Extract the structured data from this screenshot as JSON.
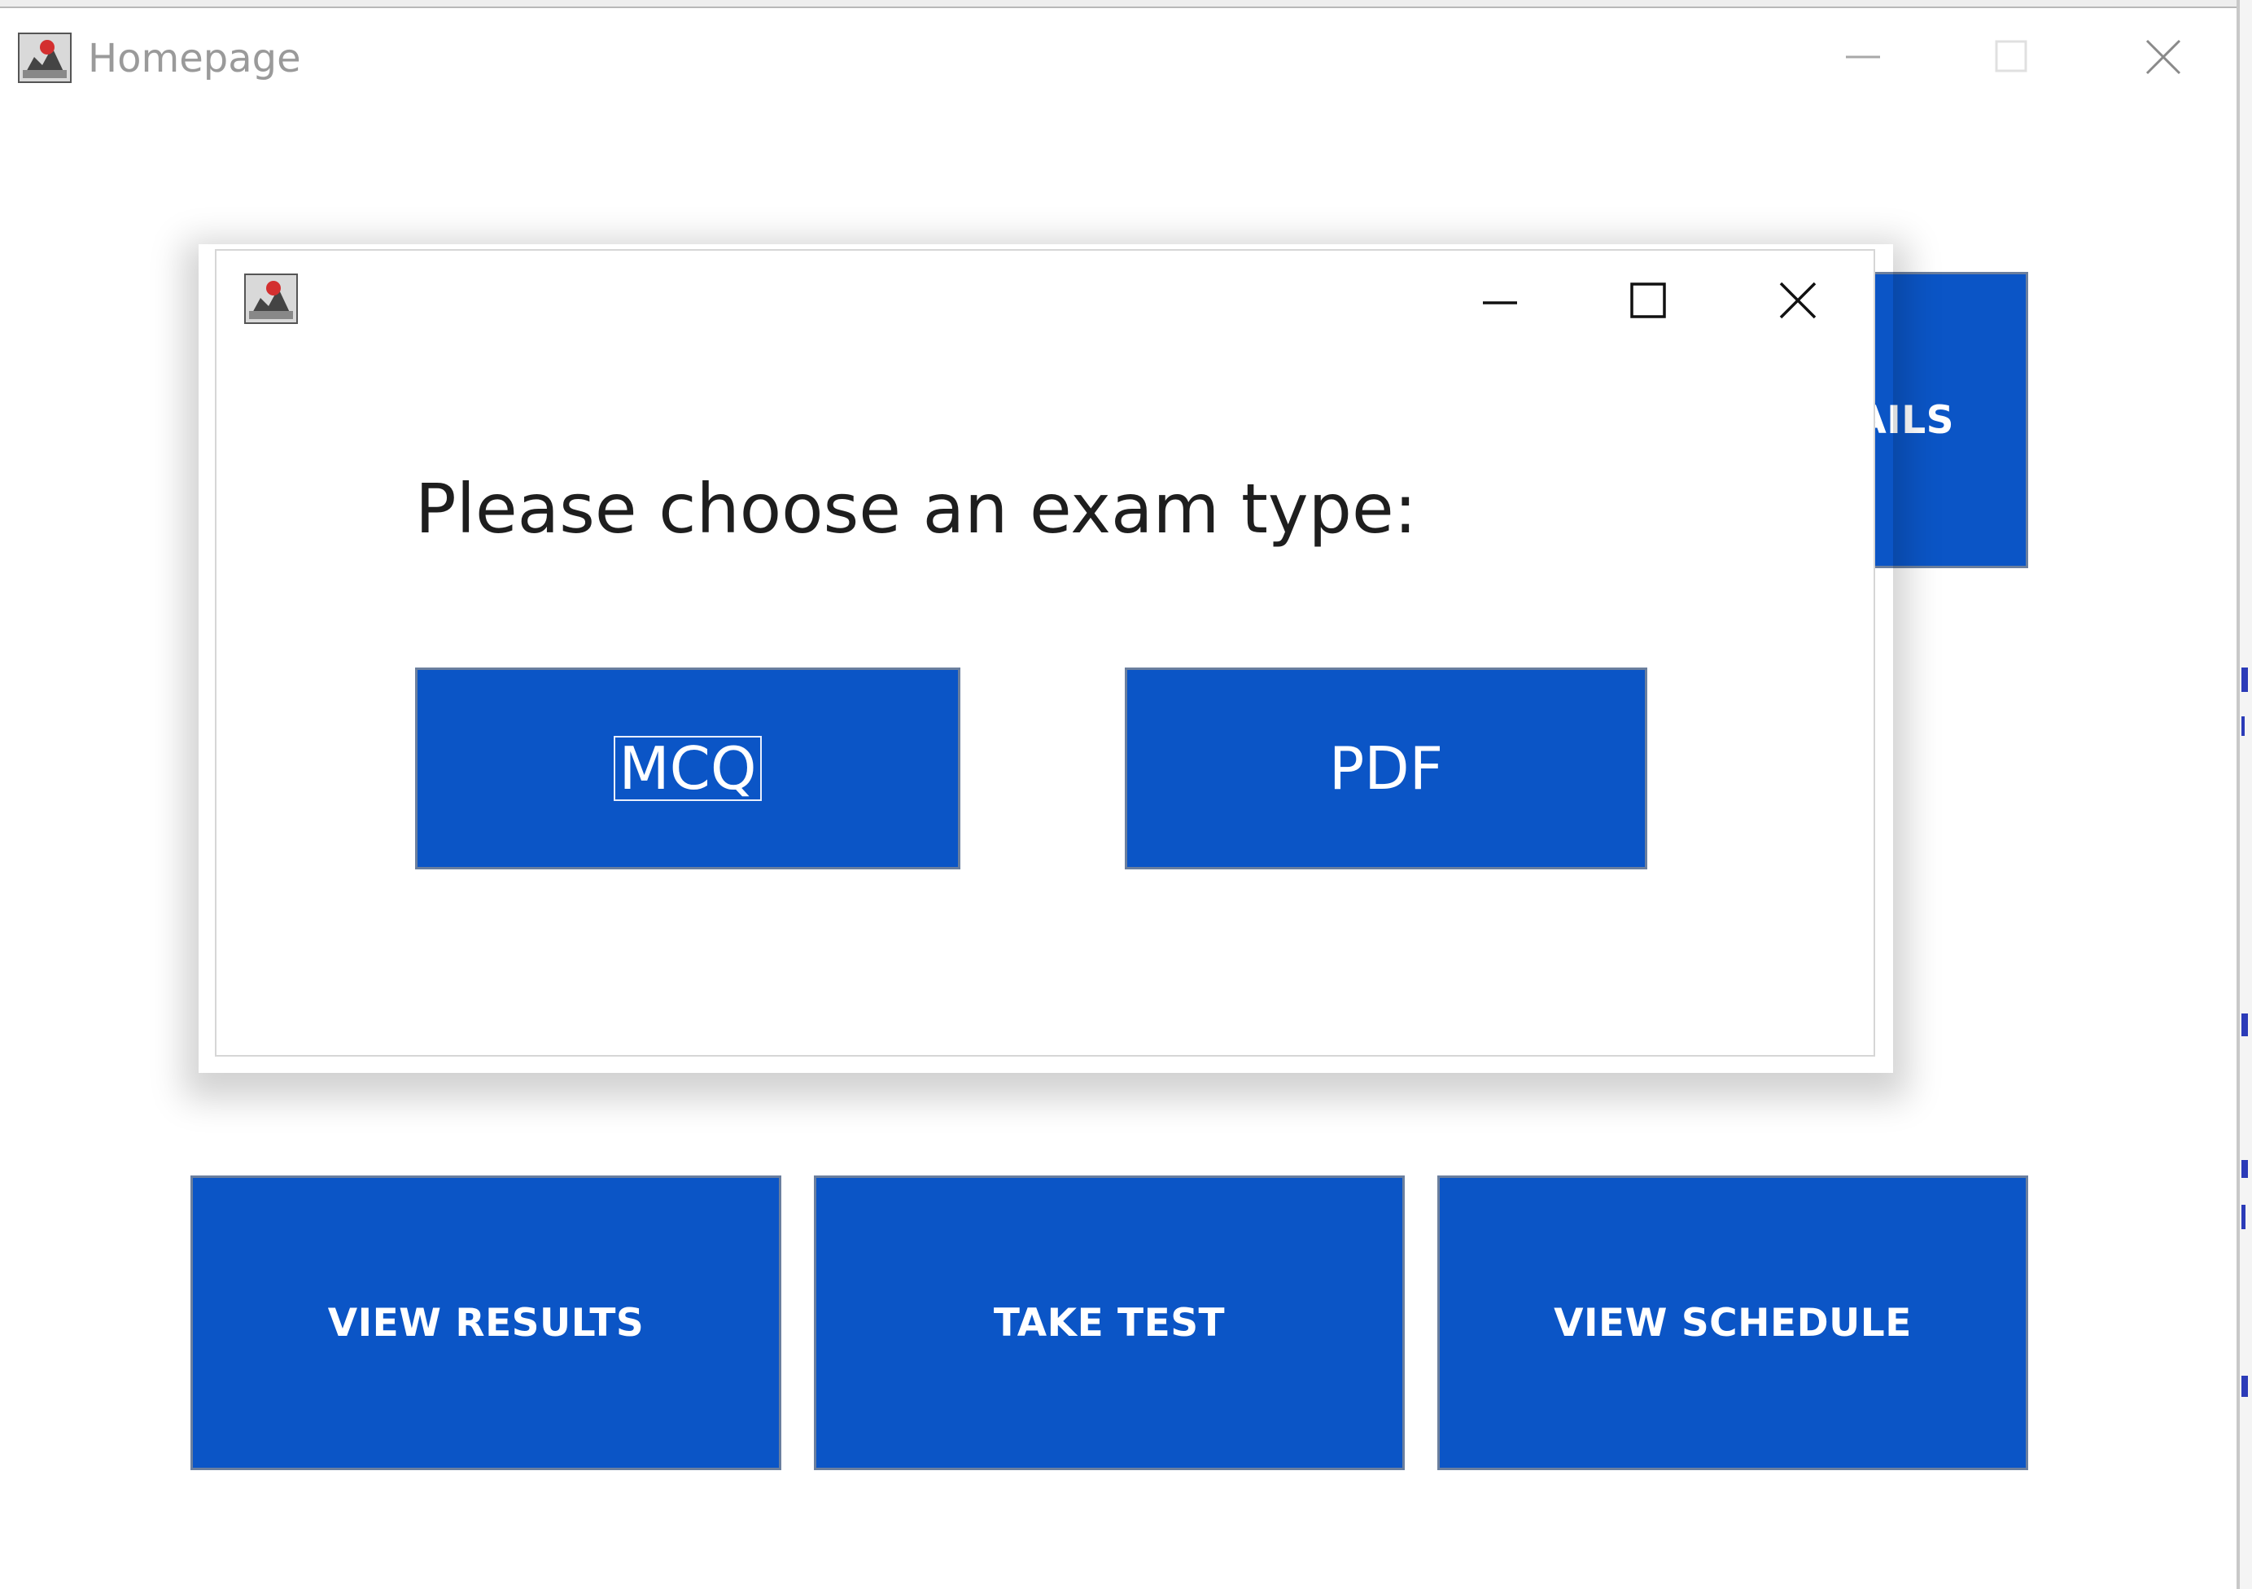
{
  "main_window": {
    "title": "Homepage",
    "controls": {
      "minimize": "minimize-icon",
      "maximize": "maximize-icon",
      "close": "close-icon"
    },
    "buttons": {
      "details_partial": "AILS",
      "view_results": "VIEW RESULTS",
      "take_test": "TAKE TEST",
      "view_schedule": "VIEW SCHEDULE"
    }
  },
  "dialog": {
    "title": "",
    "prompt": "Please choose an exam type:",
    "options": {
      "mcq": "MCQ",
      "pdf": "PDF"
    },
    "focused_option": "MCQ"
  },
  "colors": {
    "button_blue": "#0b55c6",
    "button_text": "#ffffff",
    "title_text_inactive": "#9a9a9a",
    "prompt_text": "#1e1e1e"
  }
}
